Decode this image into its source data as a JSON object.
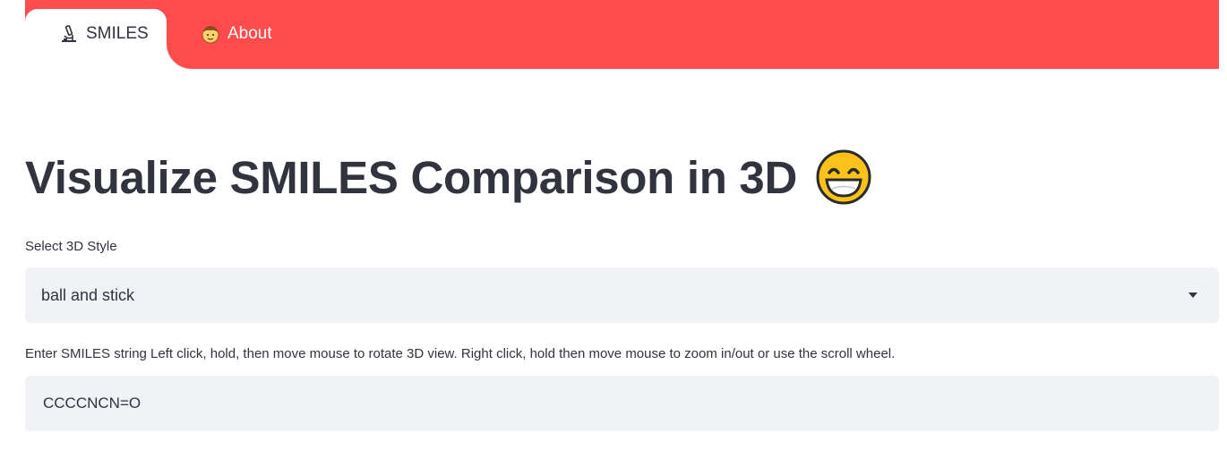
{
  "nav": {
    "tabs": [
      {
        "label": "SMILES",
        "icon": "microscope-icon",
        "active": true
      },
      {
        "label": "About",
        "icon": "person-face-icon",
        "active": false
      }
    ],
    "accent_color": "#ff4b4b"
  },
  "main": {
    "title": "Visualize SMILES Comparison in 3D",
    "title_icon": "grinning-face-icon",
    "style_select": {
      "label": "Select 3D Style",
      "value": "ball and stick"
    },
    "smiles_input": {
      "label": "Enter SMILES string Left click, hold, then move mouse to rotate 3D view. Right click, hold then move mouse to zoom in/out or use the scroll wheel.",
      "value": "CCCCNCN=O"
    }
  },
  "colors": {
    "text": "#31333f",
    "field_bg": "#f0f2f6",
    "tab_bg": "#ffffff"
  }
}
